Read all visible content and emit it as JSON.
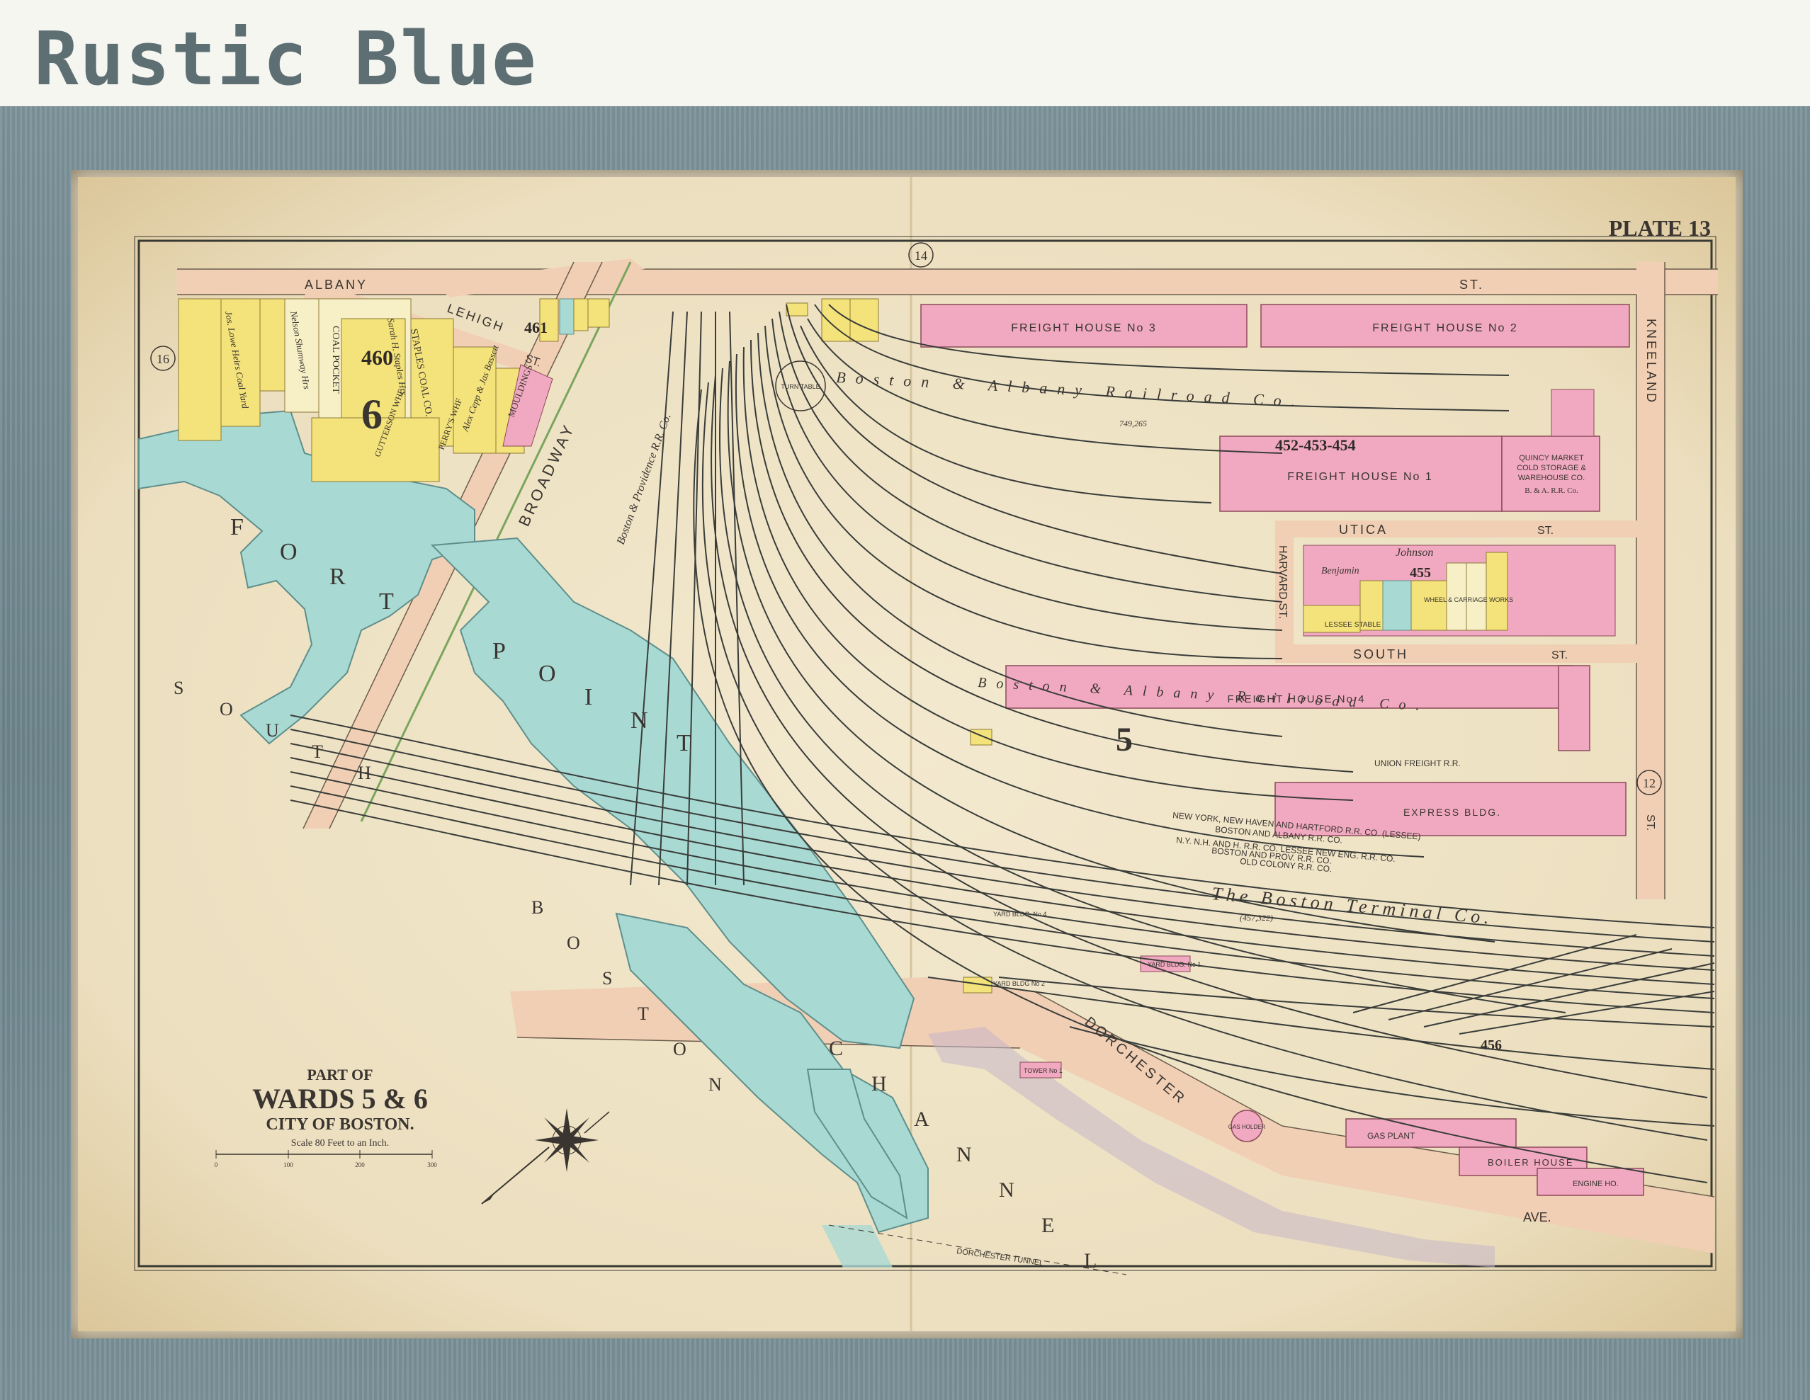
{
  "header": {
    "title": "Rustic Blue"
  },
  "map": {
    "plate": "PLATE 13",
    "title_block": {
      "line1": "PART OF",
      "line2": "WARDS 5 & 6",
      "line3": "CITY OF BOSTON.",
      "scale": "Scale 80 Feet to an Inch.",
      "scale_ticks": [
        "0",
        "100",
        "200",
        "300"
      ]
    },
    "ward_numbers": [
      "6",
      "5"
    ],
    "plate_refs": [
      "14",
      "16",
      "12"
    ],
    "streets": {
      "albany": "ALBANY",
      "st_albany": "ST.",
      "lehigh": "LEHIGH",
      "lehigh_st": "ST.",
      "broadway": "BROADWAY",
      "kneeland": "KNEELAND",
      "kneeland_st": "ST.",
      "utica": "UTICA",
      "utica_st": "ST.",
      "harvard": "HARVARD ST.",
      "south": "SOUTH",
      "south_st": "ST.",
      "dorchester": "DORCHESTER",
      "ave": "AVE.",
      "dorchester_tunnel": "DORCHESTER TUNNEL"
    },
    "water_labels": {
      "fort_point": [
        "F",
        "O",
        "R",
        "T",
        "P",
        "O",
        "I",
        "N",
        "T"
      ],
      "channel": [
        "C",
        "H",
        "A",
        "N",
        "N",
        "E",
        "L"
      ],
      "south_boston": [
        "S",
        "O",
        "U",
        "T",
        "H",
        "B",
        "O",
        "S",
        "T",
        "O",
        "N"
      ]
    },
    "buildings": {
      "fh3": "FREIGHT HOUSE No 3",
      "fh2": "FREIGHT HOUSE No 2",
      "fh1": "FREIGHT HOUSE No 1",
      "fh1_nums": "452-453-454",
      "fh4": "FREIGHT HOUSE No 4",
      "quincy": [
        "QUINCY MARKET",
        "COLD STORAGE &",
        "WAREHOUSE CO.",
        "B. & A. R.R. Co."
      ],
      "express": "EXPRESS BLDG.",
      "gas_plant": "GAS PLANT",
      "boiler": "BOILER HOUSE",
      "engine": "ENGINE HO.",
      "gas_holder": "GAS HOLDER",
      "yard4": "YARD BLDG. No 4",
      "yard2": "YARD BLDG No 2",
      "yard1": "YARD BLDG. No 1",
      "tower": "TOWER No 1",
      "turntable": "TURN TABLE",
      "coal_pocket": "COAL POCKET",
      "staples": "STAPLES COAL CO.",
      "mouldings": "MOULDINGS",
      "perrys": "PERRY'S WHF",
      "gutterson": "GUTTERSON WHF",
      "wheel_works": "WHEEL & CARRIAGE WORKS",
      "lessee_stable": "LESSEE STABLE",
      "lot_460": "460",
      "lot_461": "461",
      "lot_455": "455",
      "lot_456": "456"
    },
    "railroads": {
      "ba1": "Boston & Albany Railroad Co.",
      "ba2": "Boston & Albany Railroad Co.",
      "bp": "Boston & Providence R.R. Co.",
      "terminal": "The Boston Terminal Co.",
      "union": "UNION FREIGHT R.R.",
      "nyh": "NEW YORK, NEW HAVEN AND HARTFORD R.R. CO. (LESSEE)",
      "ba_rr": "BOSTON AND ALBANY R.R. CO.",
      "nyh2": "N.Y. N.H. AND H. R.R. CO. LESSEE NEW ENG. R.R. CO.",
      "bprov": "BOSTON AND PROV. R.R. CO.",
      "oldcolony": "OLD COLONY R.R. CO.",
      "area_ba": "749,265",
      "area_term": "(457,322)"
    },
    "owners": [
      "Johnson",
      "Benjamin",
      "Alex Cepp & Jas Bassett",
      "Nelson Shumway Hrs",
      "Sarah H. Staples Hrs",
      "Jos. Lowe Heirs Coal Yard"
    ]
  },
  "colors": {
    "paper": "#efe4c8",
    "pink": "#f1a9c1",
    "yellow": "#f4e37a",
    "water": "#a9d9d3",
    "road": "#f1cfb4",
    "frame": "#6f868d",
    "header_text": "#5e6f74"
  }
}
